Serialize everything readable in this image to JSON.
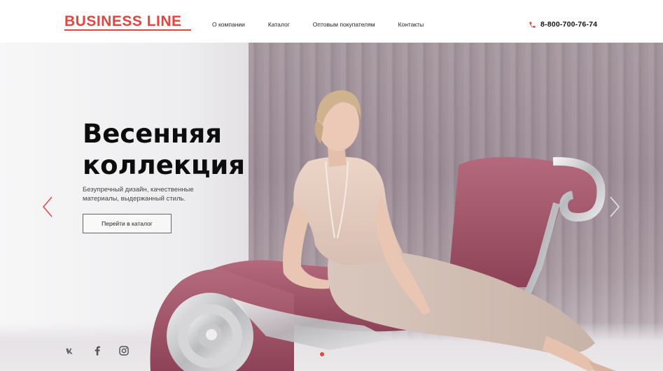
{
  "header": {
    "logo": "BUSINESS LINE",
    "nav": [
      "О компании",
      "Каталог",
      "Оптовым покупателям",
      "Контакты"
    ],
    "phone": "8-800-700-76-74"
  },
  "hero": {
    "title_line1": "Весенняя",
    "title_line2": "коллекция",
    "description": "Безупречный дизайн, качественные материалы, выдержанный стиль.",
    "cta_label": "Перейти в каталог",
    "photo_alt": "Женщина в бежевом платье на розовой кушетке"
  },
  "socials": [
    "vk-icon",
    "facebook-icon",
    "instagram-icon"
  ],
  "colors": {
    "accent": "#e8443f",
    "text": "#111111"
  }
}
